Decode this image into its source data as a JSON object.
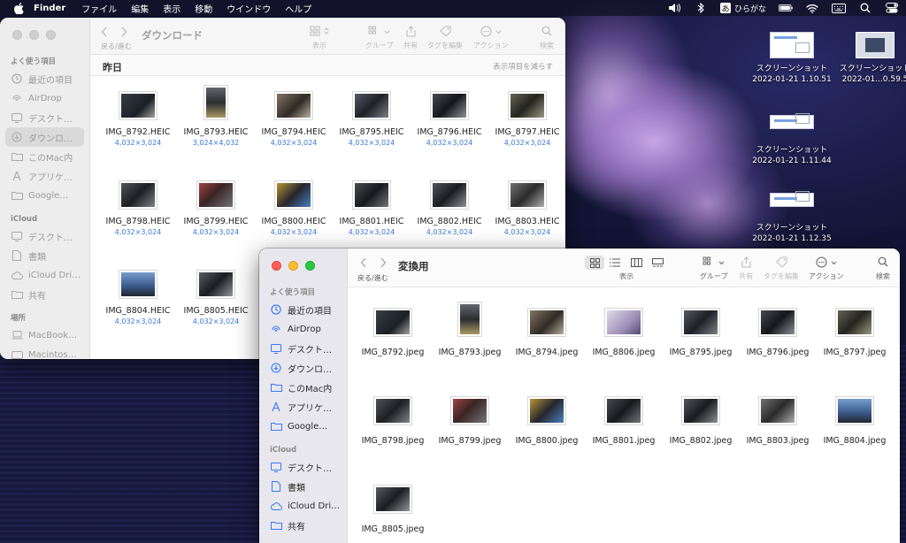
{
  "menubar": {
    "app": "Finder",
    "items": [
      "ファイル",
      "編集",
      "表示",
      "移動",
      "ウインドウ",
      "ヘルプ"
    ],
    "ime_char": "あ",
    "ime_label": "ひらがな"
  },
  "desktop_icons": [
    {
      "line1": "スクリーンショット",
      "line2": "2022-01-21 1.10.51"
    },
    {
      "line1": "スクリーンショット",
      "line2": "2022-01...0.59.5"
    },
    {
      "line1": "スクリーンショット",
      "line2": "2022-01-21 1.11.44"
    },
    {
      "line1": "スクリーンショット",
      "line2": "2022-01-21 1.12.35"
    }
  ],
  "back_window": {
    "title": "ダウンロード",
    "nav_label": "戻る/進む",
    "toolbar": {
      "view": "表示",
      "group": "グループ",
      "share": "共有",
      "tags": "タグを編集",
      "action": "アクション",
      "search": "検索"
    },
    "section": {
      "title": "昨日",
      "action": "表示項目を減らす"
    },
    "sidebar": {
      "favorites_header": "よく使う項目",
      "favorites": [
        "最近の項目",
        "AirDrop",
        "デスクト…",
        "ダウンロ…",
        "このMac内",
        "アプリケ…",
        "Google…"
      ],
      "icloud_header": "iCloud",
      "icloud": [
        "デスクト…",
        "書類",
        "iCloud Dri…",
        "共有"
      ],
      "places_header": "場所",
      "places": [
        "MacBook…",
        "Macintos…"
      ]
    },
    "files": [
      {
        "name": "IMG_8792.HEIC",
        "dims": "4,032×3,024"
      },
      {
        "name": "IMG_8793.HEIC",
        "dims": "3,024×4,032"
      },
      {
        "name": "IMG_8794.HEIC",
        "dims": "4,032×3,024"
      },
      {
        "name": "IMG_8795.HEIC",
        "dims": "4,032×3,024"
      },
      {
        "name": "IMG_8796.HEIC",
        "dims": "4,032×3,024"
      },
      {
        "name": "IMG_8797.HEIC",
        "dims": "4,032×3,024"
      },
      {
        "name": "IMG_8798.HEIC",
        "dims": "4,032×3,024"
      },
      {
        "name": "IMG_8799.HEIC",
        "dims": "4,032×3,024"
      },
      {
        "name": "IMG_8800.HEIC",
        "dims": "4,032×3,024"
      },
      {
        "name": "IMG_8801.HEIC",
        "dims": "4,032×3,024"
      },
      {
        "name": "IMG_8802.HEIC",
        "dims": "4,032×3,024"
      },
      {
        "name": "IMG_8803.HEIC",
        "dims": "4,032×3,024"
      },
      {
        "name": "IMG_8804.HEIC",
        "dims": "4,032×3,024"
      },
      {
        "name": "IMG_8805.HEIC",
        "dims": "4,032×3,024"
      }
    ]
  },
  "front_window": {
    "title": "変換用",
    "nav_label": "戻る/進む",
    "toolbar": {
      "view": "表示",
      "group": "グループ",
      "share": "共有",
      "tags": "タグを編集",
      "action": "アクション",
      "search": "検索"
    },
    "sidebar": {
      "favorites_header": "よく使う項目",
      "favorites": [
        "最近の項目",
        "AirDrop",
        "デスクト…",
        "ダウンロ…",
        "このMac内",
        "アプリケ…",
        "Google…"
      ],
      "icloud_header": "iCloud",
      "icloud": [
        "デスクト…",
        "書類",
        "iCloud Dri…",
        "共有"
      ]
    },
    "files": [
      "IMG_8792.jpeg",
      "IMG_8793.jpeg",
      "IMG_8794.jpeg",
      "IMG_8806.jpeg",
      "IMG_8795.jpeg",
      "IMG_8796.jpeg",
      "IMG_8797.jpeg",
      "IMG_8798.jpeg",
      "IMG_8799.jpeg",
      "IMG_8800.jpeg",
      "IMG_8801.jpeg",
      "IMG_8802.jpeg",
      "IMG_8803.jpeg",
      "IMG_8804.jpeg",
      "IMG_8805.jpeg"
    ]
  },
  "colors": {
    "accent": "#3478f6",
    "dim_link": "#3a78d8"
  }
}
